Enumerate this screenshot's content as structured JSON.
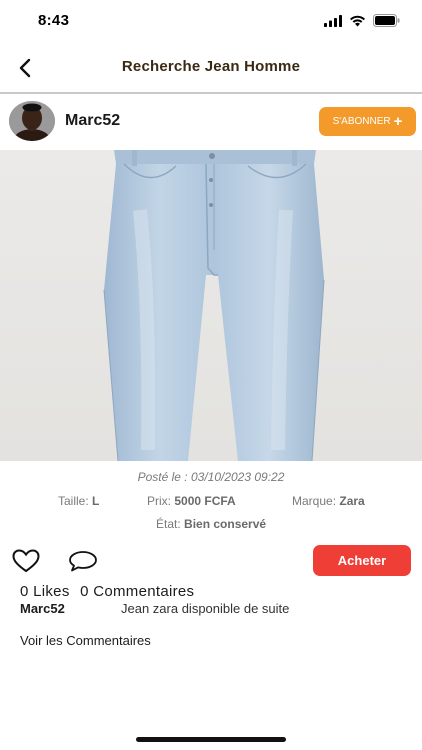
{
  "status_bar": {
    "time": "8:43"
  },
  "nav": {
    "title": "Recherche Jean Homme"
  },
  "author": {
    "username": "Marc52",
    "subscribe_label": "S'ABONNER",
    "subscribe_icon": "+"
  },
  "post": {
    "posted_prefix": "Posté le :",
    "posted_date": "03/10/2023 09:22",
    "size_label": "Taille:",
    "size_value": "L",
    "price_label": "Prix:",
    "price_value": "5000 FCFA",
    "brand_label": "Marque:",
    "brand_value": "Zara",
    "state_label": "État:",
    "state_value": "Bien conservé"
  },
  "actions": {
    "buy_label": "Acheter"
  },
  "stats": {
    "likes": "0 Likes",
    "comments": "0 Commentaires"
  },
  "caption": {
    "username": "Marc52",
    "text": "Jean zara disponible de suite"
  },
  "see_comments": "Voir les Commentaires",
  "colors": {
    "accent_orange": "#f39a2b",
    "buy_red": "#ef3e36",
    "title_brown": "#3a2a14"
  }
}
